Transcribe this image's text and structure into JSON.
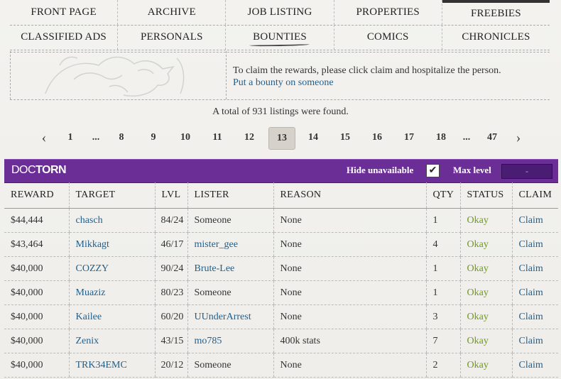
{
  "nav": {
    "row1": [
      "FRONT PAGE",
      "ARCHIVE",
      "JOB LISTING",
      "PROPERTIES",
      "FREEBIES"
    ],
    "row2": [
      "CLASSIFIED ADS",
      "PERSONALS",
      "BOUNTIES",
      "COMICS",
      "CHRONICLES"
    ],
    "active": "BOUNTIES"
  },
  "notice": {
    "text": "To claim the rewards, please click claim and hospitalize the person.",
    "link": "Put a bounty on someone"
  },
  "total_text": "A total of 931 listings were found.",
  "pagination": {
    "prev": "‹",
    "next": "›",
    "pages": [
      "1",
      "...",
      "8",
      "9",
      "10",
      "11",
      "12",
      "13",
      "14",
      "15",
      "16",
      "17",
      "18",
      "...",
      "47"
    ],
    "current": "13"
  },
  "bar": {
    "brand_light": "DOC",
    "brand_bold": "TORN",
    "hide_label": "Hide unavailable",
    "hide_checked": "✔",
    "max_level_label": "Max level",
    "max_level_value": "-",
    "color": "#6b2e97"
  },
  "table": {
    "headers": [
      "REWARD",
      "TARGET",
      "LVL",
      "LISTER",
      "REASON",
      "QTY",
      "STATUS",
      "CLAIM"
    ],
    "rows": [
      {
        "reward": "$44,444",
        "target": "chasch",
        "lvl": "84/24",
        "lister": "Someone",
        "lister_link": false,
        "reason": "None",
        "qty": "1",
        "status": "Okay",
        "claim": "Claim"
      },
      {
        "reward": "$43,464",
        "target": "Mikkagt",
        "lvl": "46/17",
        "lister": "mister_gee",
        "lister_link": true,
        "reason": "None",
        "qty": "4",
        "status": "Okay",
        "claim": "Claim"
      },
      {
        "reward": "$40,000",
        "target": "COZZY",
        "lvl": "90/24",
        "lister": "Brute-Lee",
        "lister_link": true,
        "reason": "None",
        "qty": "1",
        "status": "Okay",
        "claim": "Claim"
      },
      {
        "reward": "$40,000",
        "target": "Muaziz",
        "lvl": "80/23",
        "lister": "Someone",
        "lister_link": false,
        "reason": "None",
        "qty": "1",
        "status": "Okay",
        "claim": "Claim"
      },
      {
        "reward": "$40,000",
        "target": "Kailee",
        "lvl": "60/20",
        "lister": "UUnderArrest",
        "lister_link": true,
        "reason": "None",
        "qty": "3",
        "status": "Okay",
        "claim": "Claim"
      },
      {
        "reward": "$40,000",
        "target": "Zenix",
        "lvl": "43/15",
        "lister": "mo785",
        "lister_link": true,
        "reason": "400k stats",
        "qty": "7",
        "status": "Okay",
        "claim": "Claim"
      },
      {
        "reward": "$40,000",
        "target": "TRK34EMC",
        "lvl": "20/12",
        "lister": "Someone",
        "lister_link": false,
        "reason": "None",
        "qty": "2",
        "status": "Okay",
        "claim": "Claim"
      }
    ]
  },
  "colors": {
    "link": "#1f5f8e",
    "okay": "#6f9a1c",
    "bar": "#6b2e97"
  }
}
